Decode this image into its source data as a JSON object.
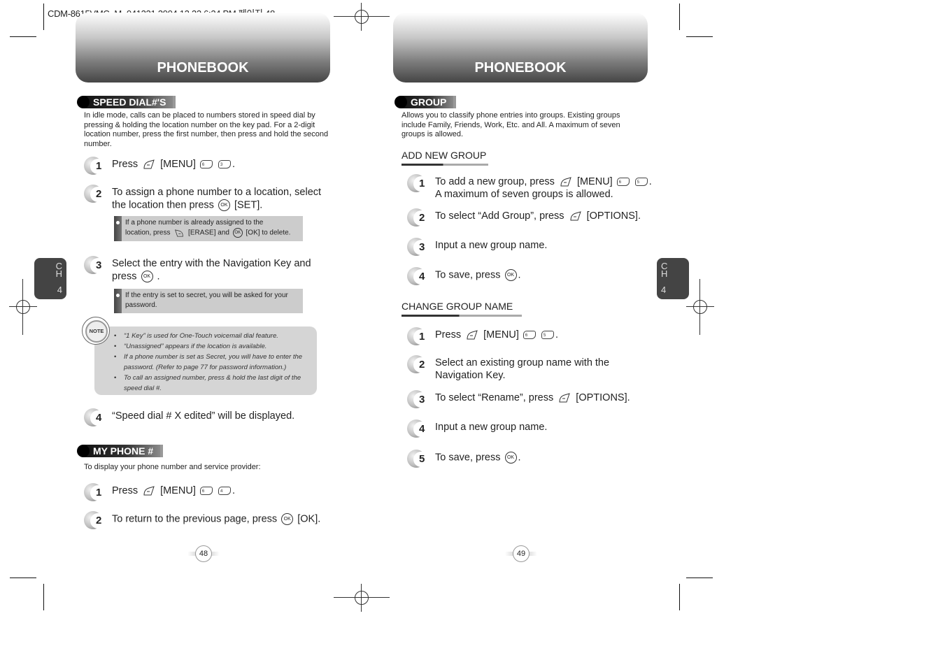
{
  "slug": "CDM-8615VMC_M_041221  2004.12.22 6:24 PM 페이지 48",
  "chapter_tab": {
    "ch": "CH",
    "c": "C",
    "h": "H",
    "number": "4"
  },
  "left_page": {
    "banner_title": "PHONEBOOK",
    "page_number": "48",
    "speed_dial": {
      "heading": "SPEED DIAL#'S",
      "intro": "In idle mode, calls can be placed to numbers stored in speed dial by pressing & holding the location number on the key pad. For a 2-digit location number, press the first number, then press and hold the second number.",
      "steps": [
        {
          "num": "1",
          "pre": "Press",
          "mid": "[MENU]",
          "key1": "6",
          "key2": "3",
          "end": "."
        },
        {
          "num": "2",
          "line1": "To assign a phone number to a location, select",
          "line2_pre": "the location then press",
          "ok": "OK",
          "line2_post": "[SET]."
        },
        {
          "num": "3",
          "line1": "Select the entry with the Navigation Key and",
          "line2_pre": "press",
          "ok": "OK",
          "line2_post": "."
        },
        {
          "num": "4",
          "text": "“Speed dial # X edited” will be displayed."
        }
      ],
      "tip1": {
        "line1": "If a phone number is already assigned to the",
        "line2_pre": "location, press",
        "erase": "[ERASE] and",
        "ok": "OK",
        "line2_post": "[OK] to delete."
      },
      "tip2": {
        "text": "If the entry is set to secret, you will be asked for your password."
      },
      "note_badge": "NOTE",
      "notes": [
        "“1 Key” is used for One-Touch voicemail dial feature.",
        "“Unassigned” appears if the location is available.",
        "If a phone number is set as Secret, you will have to enter the password. (Refer to page 77 for password information.)",
        "To call an assigned number, press & hold the last digit of the speed dial #."
      ]
    },
    "my_phone": {
      "heading": "MY PHONE #",
      "intro": "To display your phone number and service provider:",
      "steps": [
        {
          "num": "1",
          "pre": "Press",
          "mid": "[MENU]",
          "key1": "6",
          "key2": "4",
          "end": "."
        },
        {
          "num": "2",
          "pre": "To return to the previous page, press",
          "ok": "OK",
          "post": "[OK]."
        }
      ]
    }
  },
  "right_page": {
    "banner_title": "PHONEBOOK",
    "page_number": "49",
    "group": {
      "heading": "GROUP",
      "intro": "Allows you to classify phone entries into groups. Existing groups include Family, Friends, Work, Etc. and All. A maximum of seven groups is allowed."
    },
    "add_new_group": {
      "title": "ADD NEW GROUP",
      "steps": [
        {
          "num": "1",
          "pre": "To add a new group, press",
          "mid": "[MENU]",
          "key1": "6",
          "key2": "5",
          "end": ".",
          "line2": "A maximum of seven groups is allowed."
        },
        {
          "num": "2",
          "pre": "To select “Add Group”, press",
          "post": "[OPTIONS]."
        },
        {
          "num": "3",
          "text": "Input a new group name."
        },
        {
          "num": "4",
          "pre": "To save, press",
          "ok": "OK",
          "post": "."
        }
      ]
    },
    "change_group_name": {
      "title": "CHANGE GROUP NAME",
      "steps": [
        {
          "num": "1",
          "pre": "Press",
          "mid": "[MENU]",
          "key1": "6",
          "key2": "5",
          "end": "."
        },
        {
          "num": "2",
          "line1": "Select an existing group name with the",
          "line2": "Navigation Key."
        },
        {
          "num": "3",
          "pre": "To select “Rename”, press",
          "post": "[OPTIONS]."
        },
        {
          "num": "4",
          "text": "Input a new group name."
        },
        {
          "num": "5",
          "pre": "To save, press",
          "ok": "OK",
          "post": "."
        }
      ]
    }
  }
}
